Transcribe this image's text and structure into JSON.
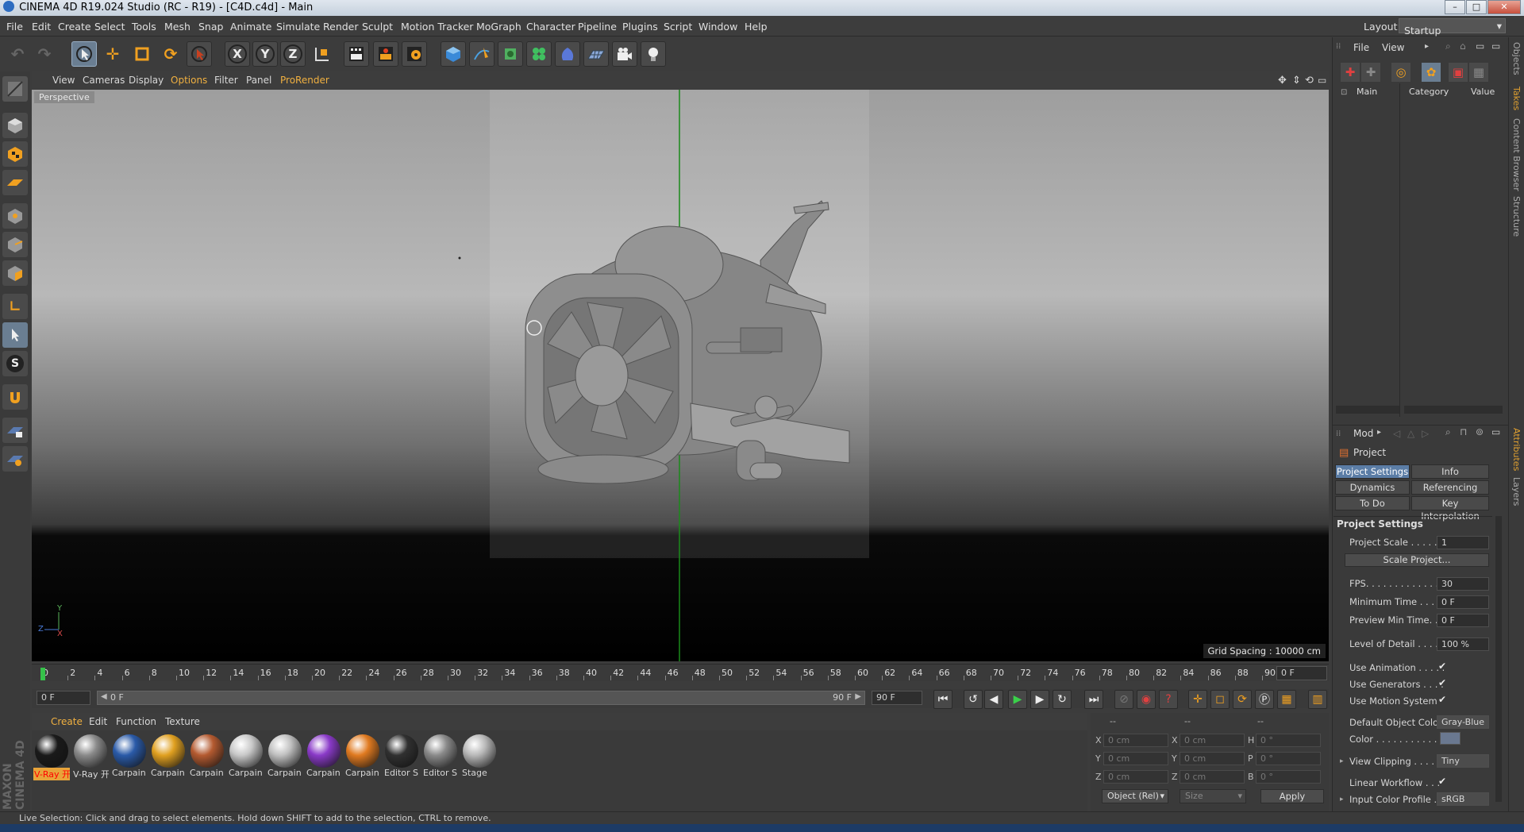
{
  "title_bar": {
    "title": "CINEMA 4D R19.024 Studio (RC - R19) - [C4D.c4d] - Main"
  },
  "menu": [
    "File",
    "Edit",
    "Create",
    "Select",
    "Tools",
    "Mesh",
    "Snap",
    "Animate",
    "Simulate",
    "Render",
    "Sculpt",
    "Motion Tracker",
    "MoGraph",
    "Character",
    "Pipeline",
    "Plugins",
    "Script",
    "Window",
    "Help"
  ],
  "layout": {
    "label": "Layout:",
    "value": "Startup"
  },
  "toolbar": {
    "axis_x": "X",
    "axis_y": "Y",
    "axis_z": "Z",
    "icons": [
      "undo-icon",
      "redo-icon",
      "live-selection-icon",
      "move-icon",
      "scale-icon",
      "rotate-icon",
      "recent-tool-icon",
      "x-axis-icon",
      "y-axis-icon",
      "z-axis-icon",
      "coordinate-system-icon",
      "render-view-icon",
      "render-picture-viewer-icon",
      "edit-render-settings-icon",
      "cube-icon",
      "pen-spline-icon",
      "subdivision-icon",
      "cloner-icon",
      "deformer-icon",
      "floor-icon",
      "camera-icon",
      "light-icon"
    ]
  },
  "viewport": {
    "menu": [
      "View",
      "Cameras",
      "Display",
      "Options",
      "Filter",
      "Panel",
      "ProRender"
    ],
    "label": "Perspective",
    "grid_spacing": "Grid Spacing : 10000 cm",
    "axis_x": "X",
    "axis_y": "Y",
    "axis_z": "Z"
  },
  "timeline": {
    "ticks": [
      "0",
      "2",
      "4",
      "6",
      "8",
      "10",
      "12",
      "14",
      "16",
      "18",
      "20",
      "22",
      "24",
      "26",
      "28",
      "30",
      "32",
      "34",
      "36",
      "38",
      "40",
      "42",
      "44",
      "46",
      "48",
      "50",
      "52",
      "54",
      "56",
      "58",
      "60",
      "62",
      "64",
      "66",
      "68",
      "70",
      "72",
      "74",
      "76",
      "78",
      "80",
      "82",
      "84",
      "86",
      "88",
      "90"
    ],
    "current_frame": "0 F",
    "start_frame": "0 F",
    "slider_start": "0 F",
    "slider_end": "90 F",
    "end_frame": "90 F"
  },
  "materials": {
    "menu": [
      "Create",
      "Edit",
      "Function",
      "Texture"
    ],
    "items": [
      {
        "label": "V-Ray 开",
        "color": "#1a1a1a"
      },
      {
        "label": "V-Ray 开",
        "color": "#8a8a8a"
      },
      {
        "label": "Carpain",
        "color": "#2a5aa8"
      },
      {
        "label": "Carpain",
        "color": "#e0a020"
      },
      {
        "label": "Carpain",
        "color": "#b45a30"
      },
      {
        "label": "Carpain",
        "color": "#c8c8c8"
      },
      {
        "label": "Carpain",
        "color": "#c0c0c0"
      },
      {
        "label": "Carpain",
        "color": "#8a3ac8"
      },
      {
        "label": "Carpain",
        "color": "#e07a20"
      },
      {
        "label": "Editor S",
        "color": "#303030"
      },
      {
        "label": "Editor S",
        "color": "#8a8a8a"
      },
      {
        "label": "Stage",
        "color": "#b8b8b8"
      }
    ]
  },
  "coordinates": {
    "headers": [
      "--",
      "--",
      "--"
    ],
    "rows": [
      {
        "l1": "X",
        "v1": "0 cm",
        "l2": "X",
        "v2": "0 cm",
        "l3": "H",
        "v3": "0 °"
      },
      {
        "l1": "Y",
        "v1": "0 cm",
        "l2": "Y",
        "v2": "0 cm",
        "l3": "P",
        "v3": "0 °"
      },
      {
        "l1": "Z",
        "v1": "0 cm",
        "l2": "Z",
        "v2": "0 cm",
        "l3": "B",
        "v3": "0 °"
      }
    ],
    "mode": "Object (Rel)",
    "size": "Size",
    "apply": "Apply"
  },
  "status": "Live Selection: Click and drag to select elements. Hold down SHIFT to add to the selection, CTRL to remove.",
  "objects_panel": {
    "menu": [
      "File",
      "View"
    ],
    "columns": [
      "Main",
      "Category",
      "Value"
    ]
  },
  "attributes_panel": {
    "mode": "Mod",
    "object": "Project",
    "tabs": [
      "Project Settings",
      "Info",
      "Dynamics",
      "Referencing",
      "To Do",
      "Key Interpolation"
    ],
    "section": "Project Settings",
    "props": {
      "project_scale": {
        "label": "Project Scale . . . . . .",
        "value": "1"
      },
      "scale_project": "Scale Project...",
      "fps": {
        "label": "FPS. . . . . . . . . . . . . .",
        "value": "30"
      },
      "min_time": {
        "label": "Minimum Time . . . . .",
        "value": "0 F"
      },
      "preview_min": {
        "label": "Preview Min Time. . .",
        "value": "0 F"
      },
      "lod": {
        "label": "Level of Detail . . . . . .",
        "value": "100 %"
      },
      "use_animation": {
        "label": "Use Animation . . . . .",
        "value": "✔"
      },
      "use_generators": {
        "label": "Use Generators . . . .",
        "value": "✔"
      },
      "use_motion": {
        "label": "Use Motion System",
        "value": "✔"
      },
      "default_color": {
        "label": "Default Object Color",
        "value": "Gray-Blue"
      },
      "color": {
        "label": "Color . . . . . . . . . . ."
      },
      "view_clipping": {
        "label": "View Clipping . . . . . .",
        "value": "Tiny"
      },
      "linear_workflow": {
        "label": "Linear Workflow . . .",
        "value": "✔"
      },
      "input_color": {
        "label": "Input Color Profile . .",
        "value": "sRGB"
      }
    }
  },
  "right_tabs": [
    "Objects",
    "Takes",
    "Content Browser",
    "Structure",
    "Attributes",
    "Layers"
  ],
  "maxon_logo": "MAXON CINEMA 4D"
}
